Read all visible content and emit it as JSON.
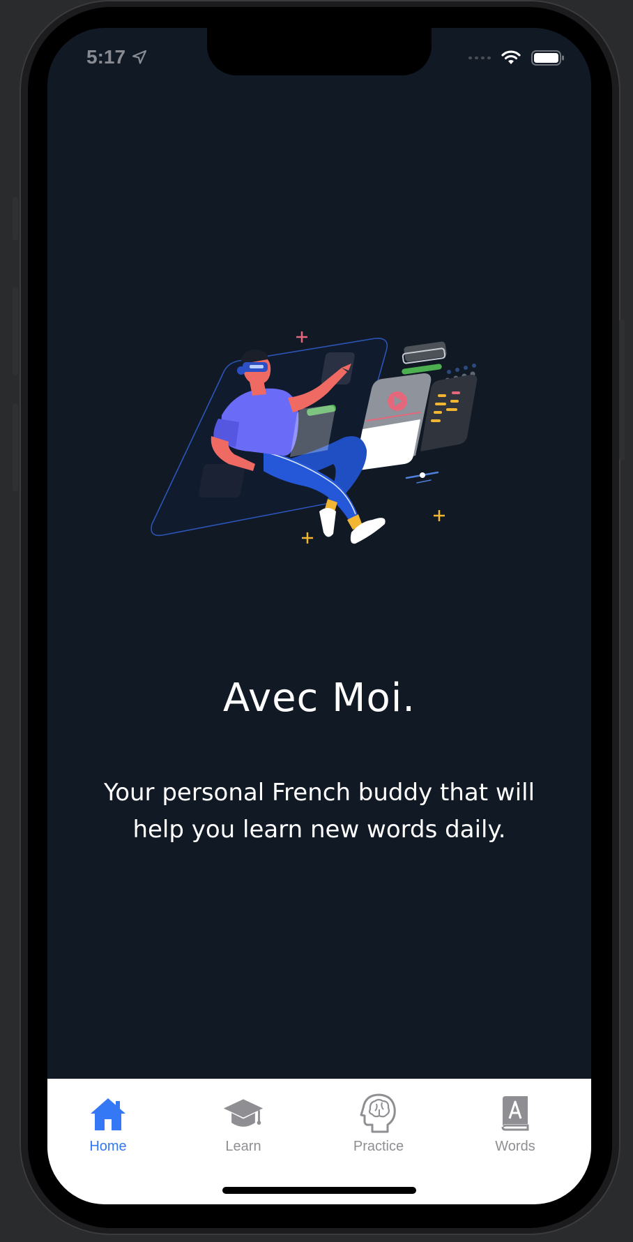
{
  "status_bar": {
    "time": "5:17",
    "location_icon": "location-arrow-icon",
    "wifi_icon": "wifi-icon",
    "battery_icon": "battery-icon"
  },
  "hero": {
    "illustration": "vr-person-illustration",
    "title": "Avec Moi.",
    "subtitle": "Your personal French buddy that will help you learn new words daily."
  },
  "tab_bar": {
    "active": "Home",
    "items": [
      {
        "label": "Home",
        "icon": "house-icon",
        "active": true
      },
      {
        "label": "Learn",
        "icon": "graduation-cap-icon",
        "active": false
      },
      {
        "label": "Practice",
        "icon": "brain-head-icon",
        "active": false
      },
      {
        "label": "Words",
        "icon": "dictionary-book-icon",
        "active": false
      }
    ]
  },
  "colors": {
    "background": "#111925",
    "accent": "#3478f6",
    "tab_inactive": "#8e8e93",
    "tab_bar_background": "#ffffff"
  }
}
